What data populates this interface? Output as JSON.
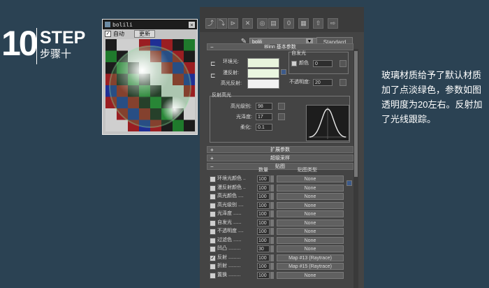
{
  "step": {
    "number": "10",
    "word": "STEP",
    "cn": "步骤十"
  },
  "description": "玻璃材质给予了默认材质加了点淡绿色，参数如图透明度为20左右。反射加了光线跟踪。",
  "preview_window": {
    "title": "bolili",
    "auto_label": "自动",
    "auto_checked": true,
    "update_button": "更新"
  },
  "editor": {
    "material_name": "bolili",
    "type_button": "Standard",
    "basic_params_title": "Blinn 基本参数",
    "self_illum_label": "自发光",
    "color_label": "颜色",
    "color_value": "0",
    "ambient_label": "环境光:",
    "diffuse_label": "漫反射:",
    "specular_label": "高光反射:",
    "opacity_label": "不透明度:",
    "opacity_value": "20",
    "specular_highlights_label": "反射高光",
    "spec_level_label": "高光级别:",
    "spec_level_value": "98",
    "glossiness_label": "光泽度:",
    "glossiness_value": "17",
    "soften_label": "柔化:",
    "soften_value": "0.1",
    "extended_params_title": "扩展参数",
    "supersampling_title": "超级采样",
    "maps_title": "贴图",
    "maps_amount_header": "数量",
    "maps_type_header": "贴图类型",
    "maps": [
      {
        "name": "环境光颜色 ..",
        "checked": false,
        "amount": "100",
        "map": "None"
      },
      {
        "name": "漫反射颜色 ..",
        "checked": false,
        "amount": "100",
        "map": "None"
      },
      {
        "name": "高光颜色 ....",
        "checked": false,
        "amount": "100",
        "map": "None"
      },
      {
        "name": "高光级别 ....",
        "checked": false,
        "amount": "100",
        "map": "None"
      },
      {
        "name": "光泽度 ......",
        "checked": false,
        "amount": "100",
        "map": "None"
      },
      {
        "name": "自发光 ......",
        "checked": false,
        "amount": "100",
        "map": "None"
      },
      {
        "name": "不透明度 ....",
        "checked": false,
        "amount": "100",
        "map": "None"
      },
      {
        "name": "过滤色 ......",
        "checked": false,
        "amount": "100",
        "map": "None"
      },
      {
        "name": "凹凸 .........",
        "checked": false,
        "amount": "30",
        "map": "None"
      },
      {
        "name": "反射 .........",
        "checked": true,
        "amount": "100",
        "map": "Map #13 (Raytrace)"
      },
      {
        "name": "折射 .........",
        "checked": false,
        "amount": "100",
        "map": "Map #15 (Raytrace)"
      },
      {
        "name": "置换 .........",
        "checked": false,
        "amount": "100",
        "map": "None"
      }
    ],
    "colors": {
      "ambient": "#e8f4dc",
      "diffuse": "#eaf6e0",
      "specular": "#f2f2f2"
    }
  }
}
